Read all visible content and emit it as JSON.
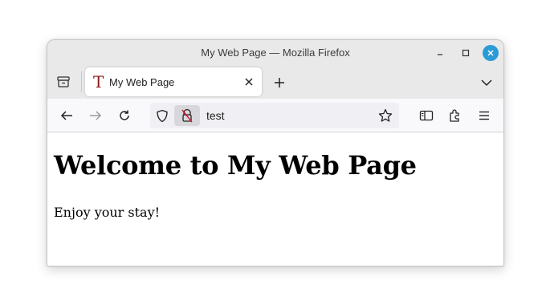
{
  "window": {
    "title": "My Web Page — Mozilla Firefox",
    "close_button_color": "#2b9bd6"
  },
  "tabbar": {
    "tabs": [
      {
        "label": "My Web Page",
        "favicon": "T",
        "favicon_color": "#8b1a1a",
        "active": true
      }
    ]
  },
  "navbar": {
    "url_value": "test",
    "icons": {
      "back": "back-arrow-icon",
      "forward": "forward-arrow-icon",
      "reload": "reload-icon",
      "tracking": "shield-icon",
      "permissions": "blocked-permission-icon",
      "bookmark": "star-icon",
      "sidebar": "sidebar-icon",
      "extensions": "extensions-icon",
      "menu": "hamburger-menu-icon"
    }
  },
  "page": {
    "heading": "Welcome to My Web Page",
    "paragraph": "Enjoy your stay!"
  }
}
